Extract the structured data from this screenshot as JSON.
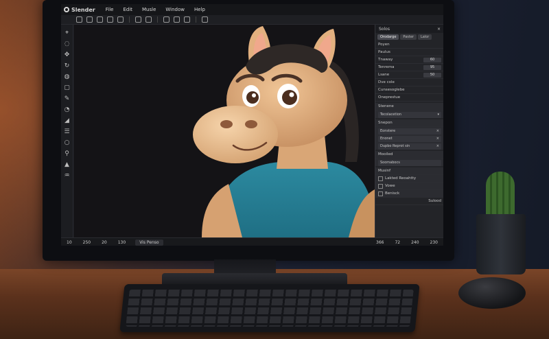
{
  "app": {
    "name": "Slender",
    "menu": [
      "File",
      "Edit",
      "Musle",
      "Window",
      "Help"
    ]
  },
  "panel": {
    "title": "Solos",
    "tabs": [
      "Orodarge",
      "Paster",
      "Lalor"
    ],
    "rows": [
      {
        "label": "Poyen",
        "value": ""
      },
      {
        "label": "Paulus",
        "value": ""
      },
      {
        "label": "Tnaway",
        "value": "60"
      },
      {
        "label": "Tenrema",
        "value": "95"
      },
      {
        "label": "Lsane",
        "value": "50"
      },
      {
        "label": "Dve cole",
        "value": ""
      },
      {
        "label": "Cunsesoglebe",
        "value": ""
      },
      {
        "label": "Oneprestue",
        "value": ""
      }
    ],
    "section1_title": "Stenene",
    "section1_field": "Tecolacetion",
    "section2_title": "Snepon",
    "section2_fields": [
      "Eonstere",
      "Enonet",
      "Dupbo Reprot sin"
    ],
    "section3_title": "Mooiled",
    "section3_field": "Soomabocs",
    "section4_title": "Musinf",
    "checkboxes": [
      "Lakted Reoahtty",
      "Vowe",
      "Benisck"
    ],
    "footer": "Sulood"
  },
  "status": {
    "left_items": [
      "10",
      "250",
      "20",
      "130"
    ],
    "mode": "Vis Penso",
    "right_items": [
      "366",
      "72",
      "240",
      "230"
    ]
  }
}
